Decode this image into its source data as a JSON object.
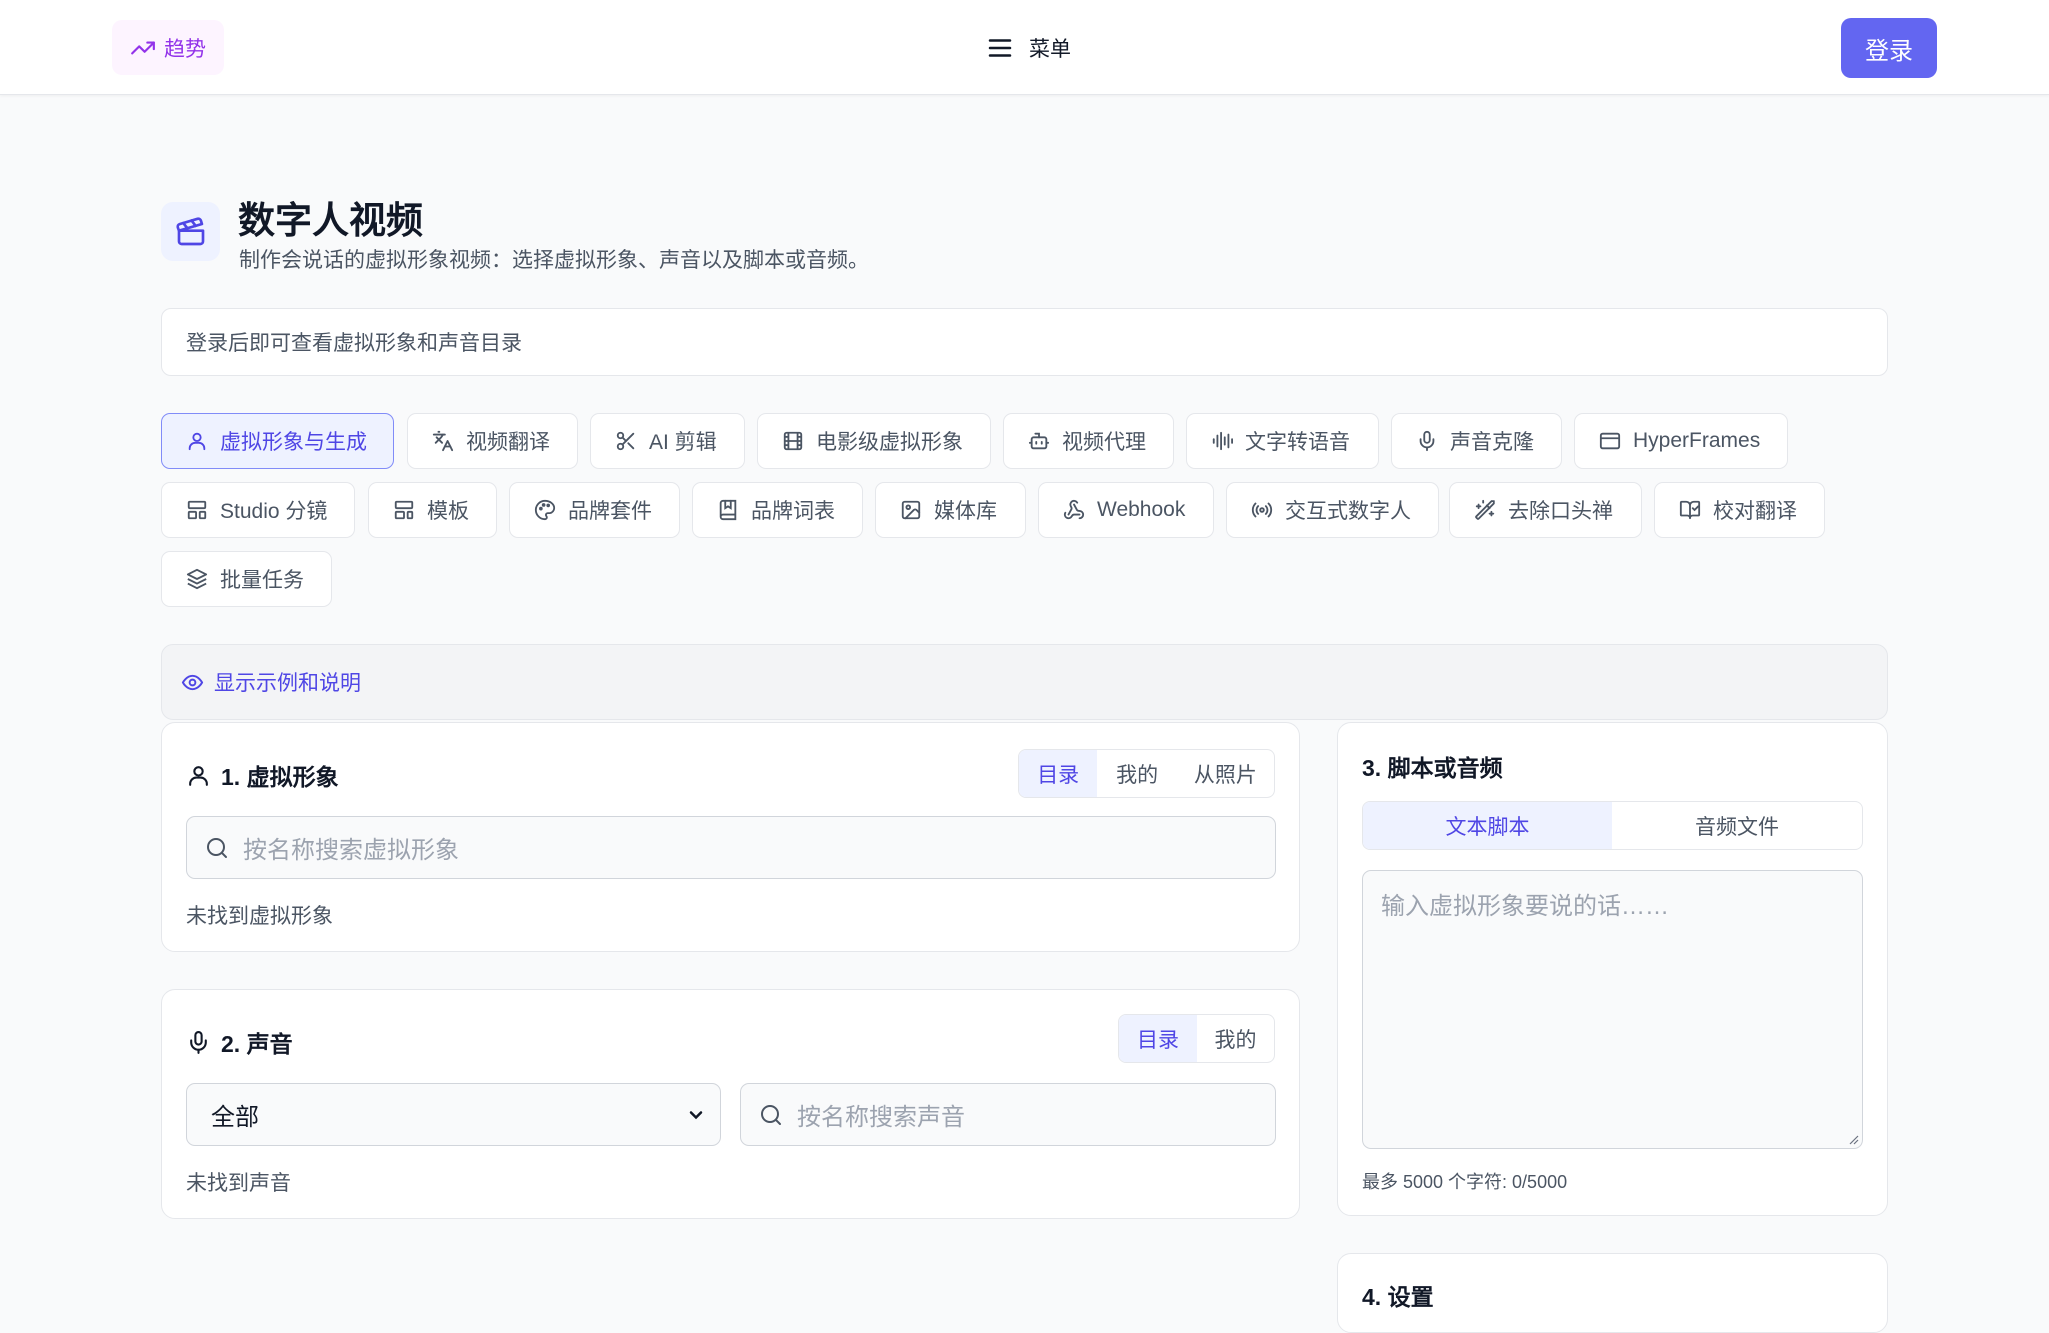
{
  "header": {
    "trend_label": "趋势",
    "menu_label": "菜单",
    "login_label": "登录"
  },
  "page": {
    "title": "数字人视频",
    "subtitle": "制作会说话的虚拟形象视频：选择虚拟形象、声音以及脚本或音频。",
    "notice": "登录后即可查看虚拟形象和声音目录"
  },
  "tabs": [
    {
      "label": "虚拟形象与生成",
      "icon": "user-icon",
      "active": true
    },
    {
      "label": "视频翻译",
      "icon": "translate-icon"
    },
    {
      "label": "AI 剪辑",
      "icon": "scissors-icon"
    },
    {
      "label": "电影级虚拟形象",
      "icon": "film-icon"
    },
    {
      "label": "视频代理",
      "icon": "bot-icon"
    },
    {
      "label": "文字转语音",
      "icon": "audio-waveform-icon"
    },
    {
      "label": "声音克隆",
      "icon": "microphone-icon"
    },
    {
      "label": "HyperFrames",
      "icon": "browser-window-icon"
    },
    {
      "label": "Studio 分镜",
      "icon": "layout-icon"
    },
    {
      "label": "模板",
      "icon": "template-icon"
    },
    {
      "label": "品牌套件",
      "icon": "palette-icon"
    },
    {
      "label": "品牌词表",
      "icon": "book-icon"
    },
    {
      "label": "媒体库",
      "icon": "image-icon"
    },
    {
      "label": "Webhook",
      "icon": "webhook-icon"
    },
    {
      "label": "交互式数字人",
      "icon": "radio-icon"
    },
    {
      "label": "去除口头禅",
      "icon": "magic-wand-icon"
    },
    {
      "label": "校对翻译",
      "icon": "book-check-icon"
    },
    {
      "label": "批量任务",
      "icon": "layers-icon"
    }
  ],
  "examples_toggle": "显示示例和说明",
  "avatar_panel": {
    "title": "1. 虚拟形象",
    "segments": [
      "目录",
      "我的",
      "从照片"
    ],
    "active_segment": "目录",
    "search_placeholder": "按名称搜索虚拟形象",
    "empty": "未找到虚拟形象"
  },
  "voice_panel": {
    "title": "2. 声音",
    "segments": [
      "目录",
      "我的"
    ],
    "active_segment": "目录",
    "select_value": "全部",
    "search_placeholder": "按名称搜索声音",
    "empty": "未找到声音"
  },
  "script_panel": {
    "title": "3. 脚本或音频",
    "segments": [
      "文本脚本",
      "音频文件"
    ],
    "active_segment": "文本脚本",
    "textarea_placeholder": "输入虚拟形象要说的话……",
    "char_count": "最多 5000 个字符: 0/5000"
  },
  "settings_panel": {
    "title": "4. 设置"
  },
  "colors": {
    "accent": "#6366f1",
    "accent_text": "#4f46e5",
    "accent_bg": "#eef2ff",
    "trend": "#9333ea"
  }
}
